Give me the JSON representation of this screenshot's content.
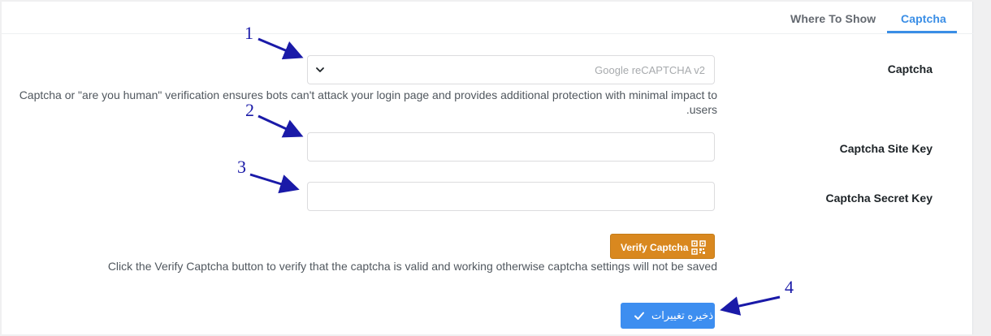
{
  "tabs": [
    {
      "label": "Where To Show"
    },
    {
      "label": "Captcha"
    }
  ],
  "form": {
    "captcha_label": "Captcha",
    "captcha_selected": "Google reCAPTCHA v2",
    "captcha_help_line1": "Captcha or \"are you human\" verification ensures bots can't attack your login page and provides additional protection with minimal impact to",
    "captcha_help_line2": ".users",
    "site_key_label": "Captcha Site Key",
    "site_key_value": "",
    "secret_key_label": "Captcha Secret Key",
    "secret_key_value": "",
    "verify_button": "Verify Captcha",
    "verify_help": "Click the Verify Captcha button to verify that the captcha is valid and working otherwise captcha settings will not be saved",
    "save_button": "ذخیره تغییرات"
  },
  "annotations": [
    "1",
    "2",
    "3",
    "4"
  ],
  "colors": {
    "accent": "#3a8ee6",
    "verify_button": "#d9881f",
    "save_button": "#3d8ef0",
    "annotation": "#1a1aa8"
  },
  "icons": {
    "select_chevron": "chevron-down-icon",
    "verify": "qr-code-icon",
    "save": "checkmark-icon"
  }
}
